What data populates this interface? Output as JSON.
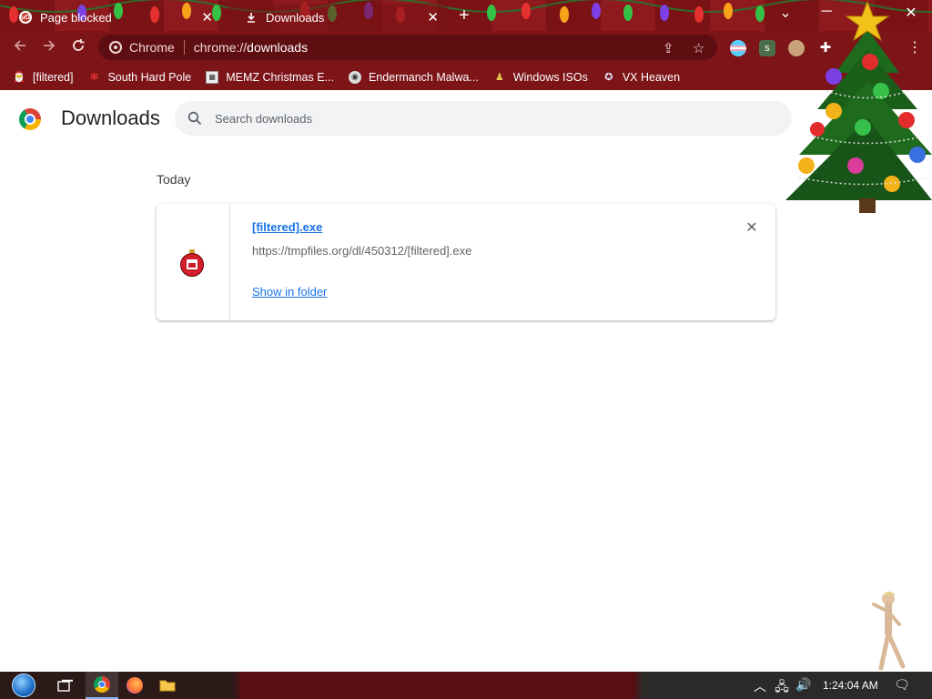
{
  "tabs": [
    {
      "title": "Page blocked",
      "icon": "ublock-icon",
      "active": false
    },
    {
      "title": "Downloads",
      "icon": "download-icon",
      "active": true
    }
  ],
  "new_tab_symbol": "+",
  "window_controls": {
    "dropdown": "⌄",
    "minimize": "─",
    "close": "✕"
  },
  "omnibox": {
    "chip_label": "Chrome",
    "url_prefix": "chrome://",
    "url_main": "downloads"
  },
  "bookmarks": [
    {
      "label": "[filtered]",
      "icon": "santa-icon"
    },
    {
      "label": "South Hard Pole",
      "icon": "snowflake-icon"
    },
    {
      "label": "MEMZ Christmas E...",
      "icon": "image-icon"
    },
    {
      "label": "Endermanch Malwa...",
      "icon": "raccoon-icon"
    },
    {
      "label": "Windows ISOs",
      "icon": "figure-icon"
    },
    {
      "label": "VX Heaven",
      "icon": "heaven-icon"
    }
  ],
  "page": {
    "title": "Downloads",
    "search_placeholder": "Search downloads"
  },
  "section_label": "Today",
  "download": {
    "file_name": "[filtered].exe",
    "url": "https://tmpfiles.org/dl/450312/[filtered].exe",
    "action_label": "Show in folder",
    "remove_symbol": "✕"
  },
  "taskbar": {
    "clock": "1:24:04 AM",
    "items": [
      "start-orb",
      "task-view-icon",
      "chrome-icon",
      "firefox-icon",
      "file-explorer-icon"
    ]
  },
  "colors": {
    "accent_red": "#7c1418",
    "link_blue": "#1a73e8",
    "text_gray": "#5f6368"
  }
}
